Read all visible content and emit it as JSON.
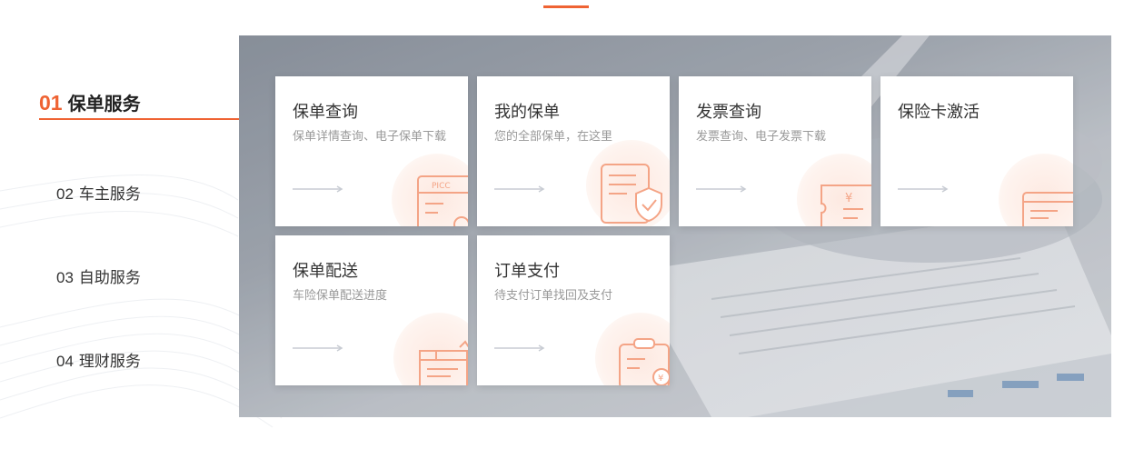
{
  "nav": {
    "items": [
      {
        "num": "01",
        "label": "保单服务",
        "active": true
      },
      {
        "num": "02",
        "label": "车主服务",
        "active": false
      },
      {
        "num": "03",
        "label": "自助服务",
        "active": false
      },
      {
        "num": "04",
        "label": "理财服务",
        "active": false
      }
    ]
  },
  "cards": [
    {
      "title": "保单查询",
      "desc": "保单详情查询、电子保单下载",
      "icon": "picc-policy-icon",
      "icon_text": "PICC"
    },
    {
      "title": "我的保单",
      "desc": "您的全部保单，在这里",
      "icon": "shield-policy-icon"
    },
    {
      "title": "发票查询",
      "desc": "发票查询、电子发票下载",
      "icon": "invoice-yen-icon",
      "icon_text": "¥"
    },
    {
      "title": "保险卡激活",
      "desc": "",
      "icon": "card-icon"
    },
    {
      "title": "保单配送",
      "desc": "车险保单配送进度",
      "icon": "delivery-box-icon"
    },
    {
      "title": "订单支付",
      "desc": "待支付订单找回及支付",
      "icon": "clipboard-pay-icon"
    }
  ],
  "colors": {
    "accent": "#ef6333",
    "icon_stroke": "#f4a486",
    "arrow": "#c8ccd3"
  }
}
